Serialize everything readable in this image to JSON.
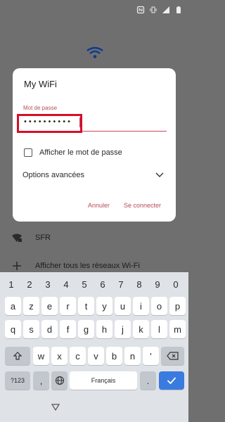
{
  "status_bar": {
    "icons": [
      "nfc-icon",
      "vibrate-icon",
      "signal-icon",
      "battery-icon"
    ]
  },
  "background": {
    "rows": [
      {
        "icon": "wifi-lock-icon",
        "label": "SFR"
      },
      {
        "icon": "plus-icon",
        "label": "Afficher tous les réseaux Wi-Fi"
      }
    ]
  },
  "dialog": {
    "title": "My WiFi",
    "password_label": "Mot de passe",
    "password_value": "••••••••••",
    "show_password_label": "Afficher le mot de passe",
    "show_password_checked": false,
    "advanced_label": "Options avancées",
    "cancel_label": "Annuler",
    "connect_label": "Se connecter"
  },
  "keyboard": {
    "row_numbers": [
      "1",
      "2",
      "3",
      "4",
      "5",
      "6",
      "7",
      "8",
      "9",
      "0"
    ],
    "row1": [
      "a",
      "z",
      "e",
      "r",
      "t",
      "y",
      "u",
      "i",
      "o",
      "p"
    ],
    "row2": [
      "q",
      "s",
      "d",
      "f",
      "g",
      "h",
      "j",
      "k",
      "l",
      "m"
    ],
    "row3": [
      "w",
      "x",
      "c",
      "v",
      "b",
      "n",
      "'"
    ],
    "symbols_label": "?123",
    "comma_label": ",",
    "space_label": "Français",
    "period_label": "."
  },
  "colors": {
    "accent": "#b64d58",
    "highlight": "#d60f2a",
    "enter": "#3a7be0"
  }
}
